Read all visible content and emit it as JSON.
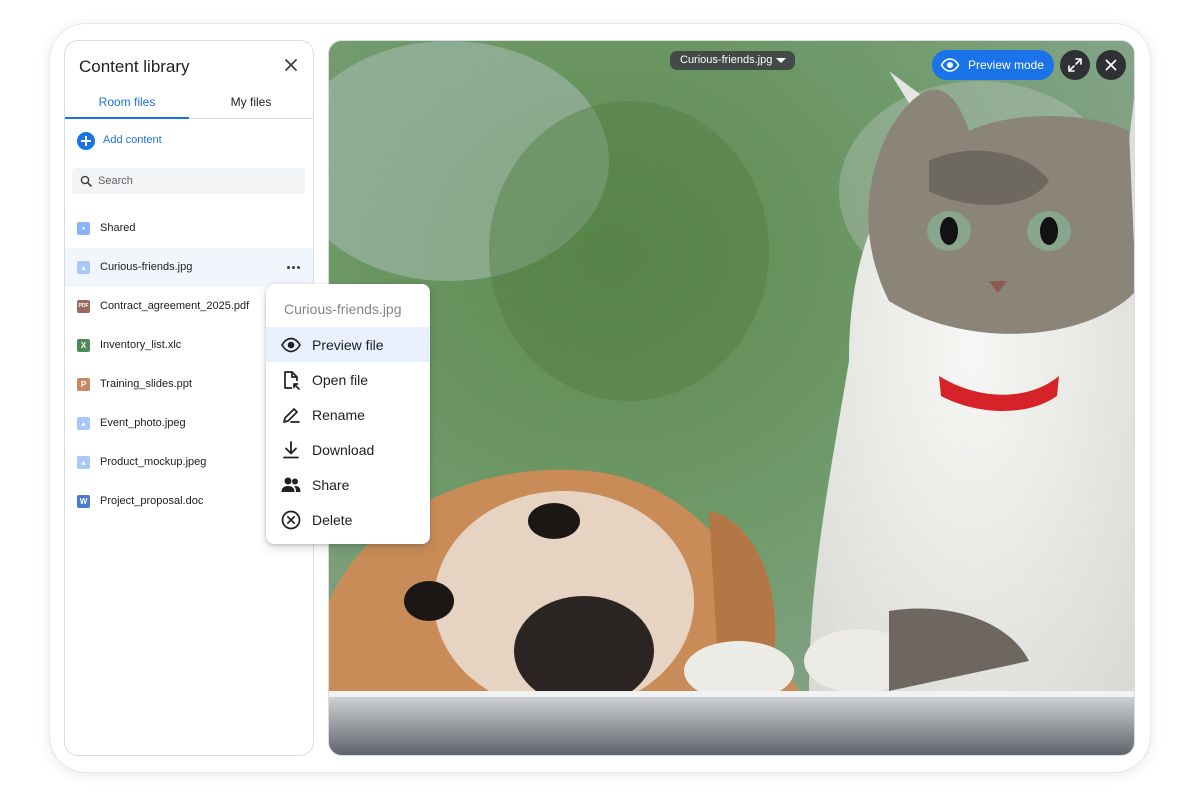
{
  "sidebar": {
    "title": "Content library",
    "tabs": [
      {
        "label": "Room files",
        "active": true
      },
      {
        "label": "My files",
        "active": false
      }
    ],
    "add_content_label": "Add content",
    "search": {
      "placeholder": "Search",
      "value": ""
    },
    "files": [
      {
        "name": "Shared",
        "icon": "folder-shared-icon"
      },
      {
        "name": "Curious-friends.jpg",
        "icon": "image-file-icon",
        "selected": true
      },
      {
        "name": "Contract_agreement_2025.pdf",
        "icon": "pdf-file-icon"
      },
      {
        "name": "Inventory_list.xlc",
        "icon": "spreadsheet-file-icon"
      },
      {
        "name": "Training_slides.ppt",
        "icon": "presentation-file-icon"
      },
      {
        "name": "Event_photo.jpeg",
        "icon": "image-file-icon"
      },
      {
        "name": "Product_mockup.jpeg",
        "icon": "image-file-icon"
      },
      {
        "name": "Project_proposal.doc",
        "icon": "document-file-icon"
      }
    ]
  },
  "context_menu": {
    "title": "Curious-friends.jpg",
    "items": [
      {
        "label": "Preview file",
        "icon": "eye-icon",
        "active": true
      },
      {
        "label": "Open file",
        "icon": "open-file-icon"
      },
      {
        "label": "Rename",
        "icon": "pen-icon"
      },
      {
        "label": "Download",
        "icon": "download-icon"
      },
      {
        "label": "Share",
        "icon": "people-icon"
      },
      {
        "label": "Delete",
        "icon": "circle-x-icon"
      }
    ]
  },
  "preview": {
    "file_chip_label": "Curious-friends.jpg",
    "preview_mode_label": "Preview mode",
    "image_subject": "cat and dog looking through window"
  },
  "colors": {
    "accent": "#1a73e8",
    "selected_row": "#f1f5fc",
    "menu_active": "#e8f0fe"
  }
}
